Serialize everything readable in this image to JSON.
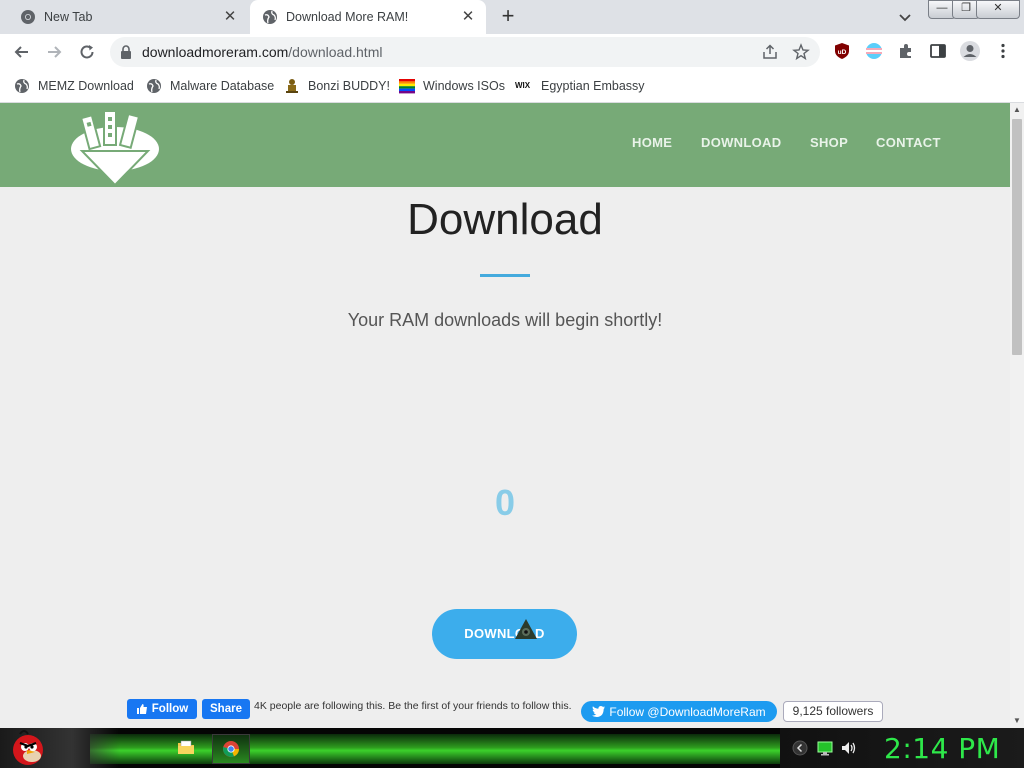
{
  "browser": {
    "tabs": [
      {
        "title": "New Tab",
        "icon": "chrome-icon",
        "active": false
      },
      {
        "title": "Download More RAM!",
        "icon": "globe-icon",
        "active": true
      }
    ],
    "new_tab_symbol": "+",
    "window_controls": {
      "minimize": "—",
      "restore": "❐",
      "close": "✕"
    },
    "url": {
      "domain": "downloadmoreram.com",
      "path": "/download.html"
    },
    "bookmarks": [
      {
        "label": "MEMZ Download",
        "icon": "globe-icon"
      },
      {
        "label": "Malware Database",
        "icon": "globe-icon"
      },
      {
        "label": "Bonzi BUDDY!",
        "icon": "bonzi-icon"
      },
      {
        "label": "Windows ISOs",
        "icon": "rainbow-flag-icon"
      },
      {
        "label": "Egyptian Embassy",
        "icon": "wix-icon"
      }
    ],
    "wix_text": "WIX",
    "ublock_text": "uD"
  },
  "site": {
    "nav": [
      "HOME",
      "DOWNLOAD",
      "SHOP",
      "CONTACT"
    ],
    "title": "Download",
    "subtitle": "Your RAM downloads will begin shortly!",
    "counter": "0",
    "download_button": "DOWNLOAD",
    "facebook": {
      "follow_label": "Follow",
      "share_label": "Share",
      "text": "4K people are following this. Be the first of your friends to follow this."
    },
    "twitter": {
      "follow_label": "Follow @DownloadMoreRam",
      "followers": "9,125 followers"
    },
    "colors": {
      "header": "#77aa77",
      "accent": "#44aadd",
      "button": "#3cadec",
      "counter": "#88cce8"
    }
  },
  "taskbar": {
    "clock": "2:14 PM",
    "clock_color": "#2ee84a"
  }
}
